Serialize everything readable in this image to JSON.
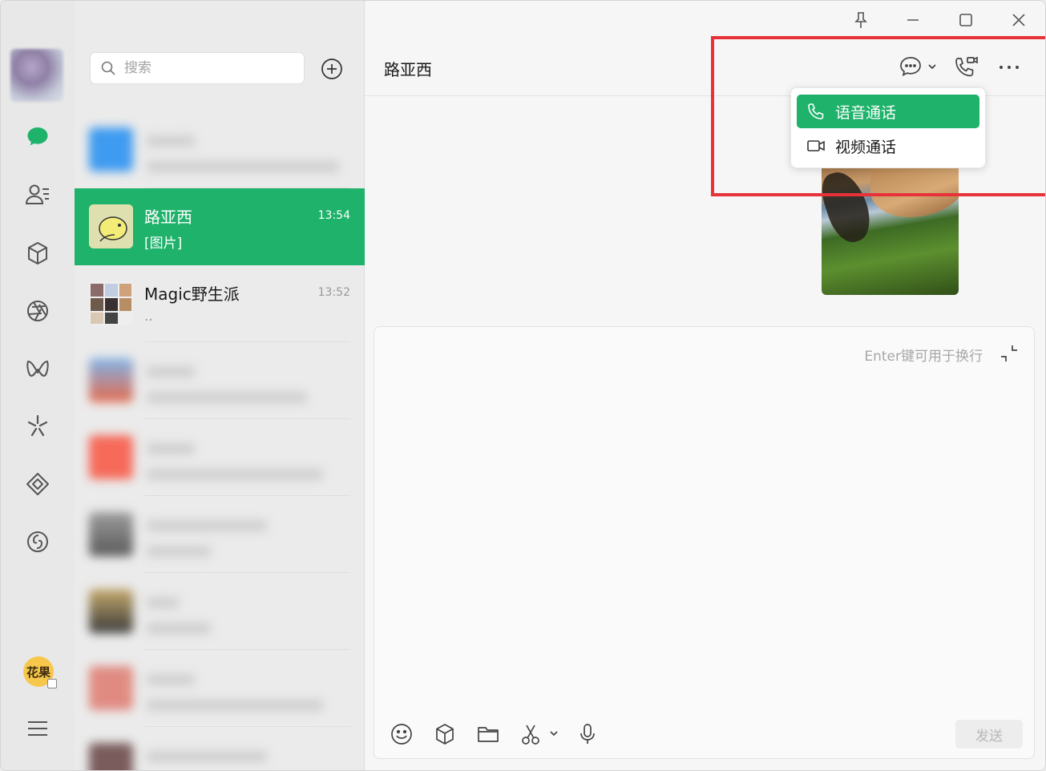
{
  "window": {
    "controls": [
      "pin",
      "minimize",
      "maximize",
      "close"
    ]
  },
  "rail": {
    "items": [
      "chat-icon",
      "contacts-icon",
      "favorites-box-icon",
      "moments-aperture-icon",
      "channels-icon",
      "discover-sparkle-icon",
      "mini-program-icon",
      "music-icon"
    ],
    "me_avatar": "花果",
    "menu_icon": "hamburger-icon",
    "accent": "#1fb26b"
  },
  "list": {
    "search_placeholder": "搜索",
    "conversations": [
      {
        "name": "",
        "time": "",
        "preview": "",
        "blurred": true
      },
      {
        "name": "路亚西",
        "time": "13:54",
        "preview": "[图片]",
        "active": true
      },
      {
        "name": "Magic野生派",
        "time": "13:52",
        "preview": ".."
      },
      {
        "name": "",
        "time": "",
        "preview": "",
        "blurred": true
      },
      {
        "name": "",
        "time": "",
        "preview": "",
        "blurred": true
      },
      {
        "name": "",
        "time": "",
        "preview": "",
        "blurred": true
      },
      {
        "name": "",
        "time": "",
        "preview": "",
        "blurred": true
      },
      {
        "name": "",
        "time": "",
        "preview": "",
        "blurred": true
      },
      {
        "name": "",
        "time": "",
        "preview": "",
        "blurred": true
      }
    ]
  },
  "chat": {
    "title": "路亚西",
    "menu": {
      "voice_call": "语音通话",
      "video_call": "视频通话"
    },
    "composer": {
      "hint": "Enter键可用于换行",
      "send": "发送"
    }
  }
}
